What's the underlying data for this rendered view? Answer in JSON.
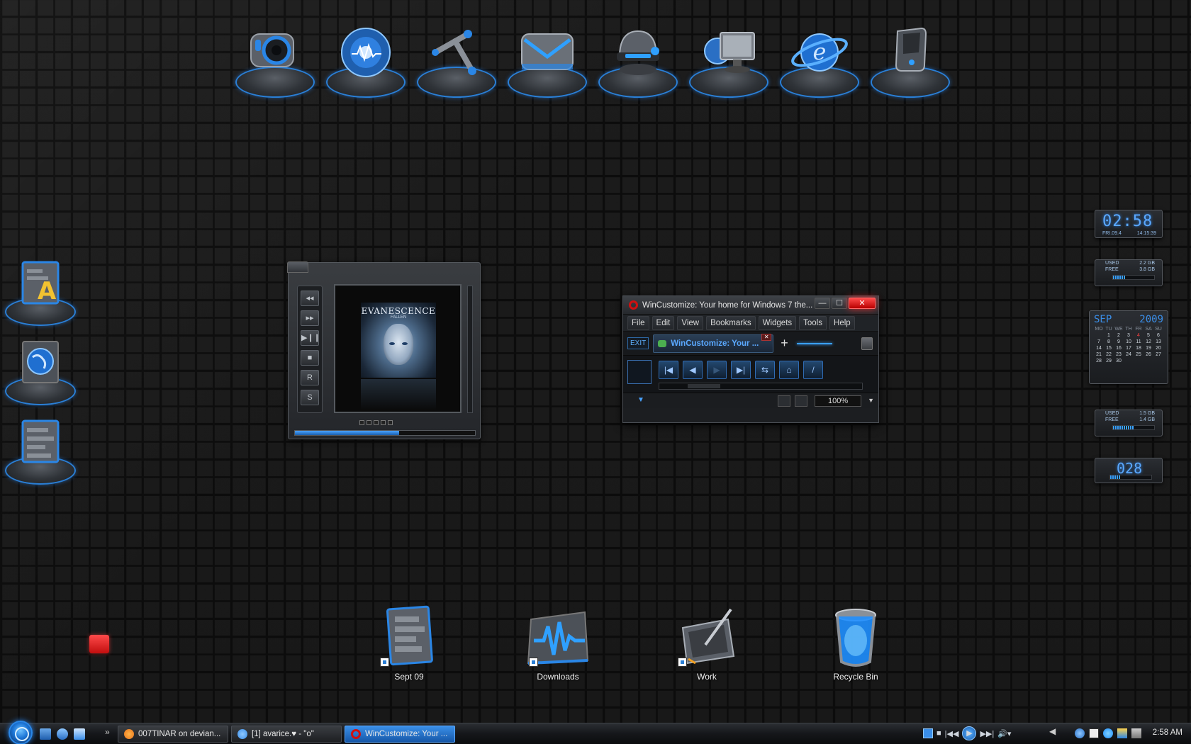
{
  "dock": {
    "items": [
      {
        "name": "webcam-icon"
      },
      {
        "name": "media-disc-icon"
      },
      {
        "name": "robot-arm-icon"
      },
      {
        "name": "mail-icon"
      },
      {
        "name": "helmet-icon"
      },
      {
        "name": "computer-icon"
      },
      {
        "name": "internet-explorer-icon"
      },
      {
        "name": "pc-tower-icon"
      }
    ]
  },
  "left_dock": {
    "items": [
      {
        "name": "font-document-icon"
      },
      {
        "name": "globe-icon"
      },
      {
        "name": "document-icon"
      }
    ]
  },
  "player": {
    "album_title": "EVANESCENCE",
    "album_subtitle": "FALLEN",
    "controls": [
      "◂◂",
      "▸▸",
      "▶❙❙",
      "■",
      "R",
      "S"
    ],
    "progress": 0.58
  },
  "browser": {
    "title": "WinCustomize: Your home for Windows 7 the...",
    "window_buttons": {
      "minimize": "—",
      "maximize": "☐",
      "close": "✕"
    },
    "menu": [
      "File",
      "Edit",
      "View",
      "Bookmarks",
      "Widgets",
      "Tools",
      "Help"
    ],
    "exit_label": "EXIT",
    "tab_label": "WinCustomize: Your ...",
    "plus_label": "+",
    "nav_buttons": [
      "|◀",
      "◀",
      "▶",
      "▶|",
      "⇆",
      "⌂",
      "/"
    ],
    "zoom": "100%",
    "status_arrow": "▼"
  },
  "gadgets": {
    "clock": {
      "time": "02:58",
      "date": "FRI.09.4",
      "seconds": "14:15:39"
    },
    "drive1": {
      "used_label": "USED",
      "used": "2.2 GB",
      "free_label": "FREE",
      "free": "3.8 GB",
      "level": 0.3
    },
    "drive2": {
      "used_label": "USED",
      "used": "1.5 GB",
      "free_label": "FREE",
      "free": "1.4 GB",
      "level": 0.5
    },
    "counter": {
      "value": "028",
      "level": 0.25
    },
    "calendar": {
      "month": "SEP",
      "year": "2009",
      "days_of_week": [
        "MO",
        "TU",
        "WE",
        "TH",
        "FR",
        "SA",
        "SU"
      ],
      "weeks": [
        [
          "",
          "1",
          "2",
          "3",
          "4",
          "5",
          "6"
        ],
        [
          "7",
          "8",
          "9",
          "10",
          "11",
          "12",
          "13"
        ],
        [
          "14",
          "15",
          "16",
          "17",
          "18",
          "19",
          "20"
        ],
        [
          "21",
          "22",
          "23",
          "24",
          "25",
          "26",
          "27"
        ],
        [
          "28",
          "29",
          "30",
          "",
          "",
          "",
          ""
        ]
      ],
      "today": "4"
    }
  },
  "desktop_icons": [
    {
      "label": "Sept 09",
      "icon": "document-icon"
    },
    {
      "label": "Downloads",
      "icon": "waveform-folder-icon"
    },
    {
      "label": "Work",
      "icon": "tablet-pen-icon"
    },
    {
      "label": "Recycle Bin",
      "icon": "recycle-bin-icon"
    }
  ],
  "taskbar": {
    "more_label": "»",
    "tasks": [
      {
        "label": "007TINAR on devian...",
        "icon_color": "#e8731c",
        "active": false
      },
      {
        "label": "[1] avarice.♥ - \"o\"",
        "icon_color": "#3a8ee8",
        "active": false
      },
      {
        "label": "WinCustomize: Your ...",
        "icon_color": "#d01010",
        "active": true
      }
    ],
    "player_controls": [
      "■",
      "|◀◀",
      "▶",
      "▶▶|",
      "🔊▾"
    ],
    "tray_collapse": "◀",
    "clock": "2:58 AM"
  },
  "colors": {
    "accent": "#2a7fd6",
    "glow": "#3aa0ff",
    "close_red": "#e01818"
  }
}
